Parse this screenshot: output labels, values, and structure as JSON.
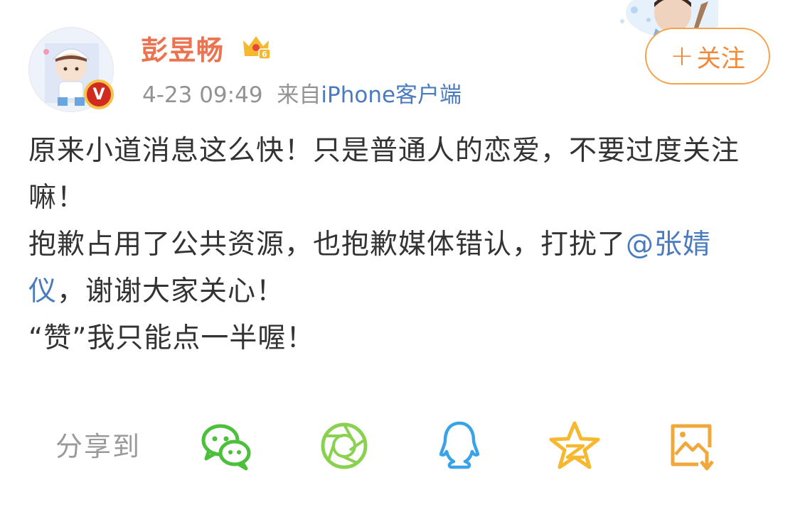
{
  "header": {
    "username": "彭昱畅",
    "member_level": "6",
    "verified": "V",
    "timestamp": "4-23 09:49",
    "source_prefix": "来自",
    "source_client": "iPhone客户端",
    "follow_plus": "+",
    "follow_label": "关注"
  },
  "post": {
    "line1": "原来小道消息这么快！只是普通人的恋爱，不要过度关注嘛！",
    "line2_before": "抱歉占用了公共资源，也抱歉媒体错认，打扰了",
    "mention": "@张婧仪",
    "line2_after": "，谢谢大家关心！",
    "line3": "“赞”我只能点一半喔！"
  },
  "share": {
    "label": "分享到",
    "icons": [
      "wechat-icon",
      "moments-icon",
      "qq-icon",
      "qzone-icon",
      "save-image-icon"
    ]
  },
  "colors": {
    "username": "#eb7350",
    "link": "#4a7bbf",
    "follow": "#f08a3a",
    "wechat": "#4cbf3c",
    "moments": "#8bd150",
    "qq": "#3aa3e8",
    "qzone": "#f5b82e",
    "save": "#f0a83a"
  }
}
